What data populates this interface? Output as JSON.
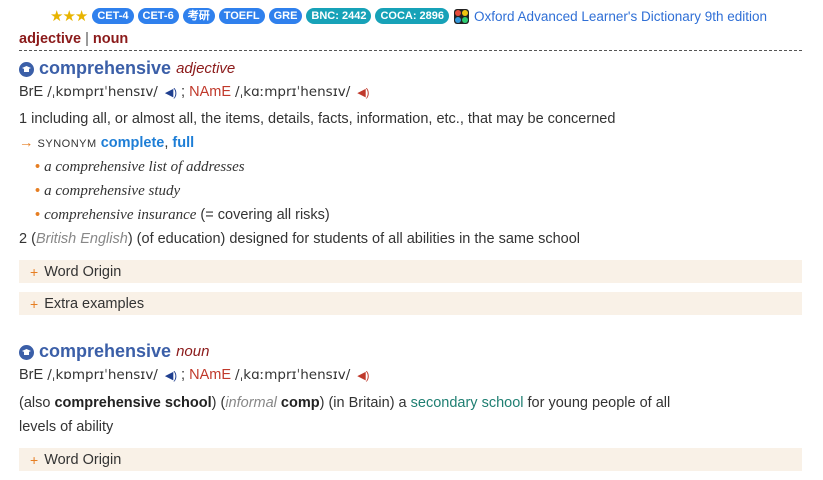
{
  "header": {
    "stars": "★★★",
    "tags": [
      "CET-4",
      "CET-6",
      "考研",
      "TOEFL",
      "GRE"
    ],
    "freq_tags": [
      "BNC: 2442",
      "COCA: 2896"
    ],
    "dictionary_name": "Oxford Advanced Learner's Dictionary 9th edition"
  },
  "pos_nav": {
    "adjective": "adjective",
    "separator": "|",
    "noun": "noun"
  },
  "entries": [
    {
      "headword": "comprehensive",
      "pos": "adjective",
      "pron": {
        "br_label": "BrE",
        "br_ipa": "/ˌkɒmprɪˈhensɪv/",
        "semi": ";",
        "am_label": "NAmE",
        "am_ipa": "/ˌkɑːmprɪˈhensɪv/"
      },
      "sense1": "1 including all, or almost all, the items, details, facts, information, etc., that may be concerned",
      "synonym": {
        "label": "synonym",
        "word1": "complete",
        "comma": ",",
        "word2": "full"
      },
      "examples": [
        {
          "text": "a comprehensive list of addresses",
          "gloss": ""
        },
        {
          "text": "a comprehensive study",
          "gloss": ""
        },
        {
          "text": "comprehensive insurance",
          "gloss": " (= covering all risks)"
        }
      ],
      "sense2": {
        "num": "2",
        "label": "British English",
        "text": "(of education) designed for students of all abilities in the same school"
      },
      "folds": [
        "Word Origin",
        "Extra examples"
      ]
    },
    {
      "headword": "comprehensive",
      "pos": "noun",
      "pron": {
        "br_label": "BrE",
        "br_ipa": "/ˌkɒmprɪˈhensɪv/",
        "semi": ";",
        "am_label": "NAmE",
        "am_ipa": "/ˌkɑːmprɪˈhensɪv/"
      },
      "def": {
        "also": "also",
        "phrase": "comprehensive school",
        "register": "informal",
        "short": "comp",
        "region": "(in Britain) a",
        "link": "secondary school",
        "rest1": "for young people of all",
        "rest2": "levels of ability"
      },
      "folds": [
        "Word Origin"
      ]
    }
  ]
}
